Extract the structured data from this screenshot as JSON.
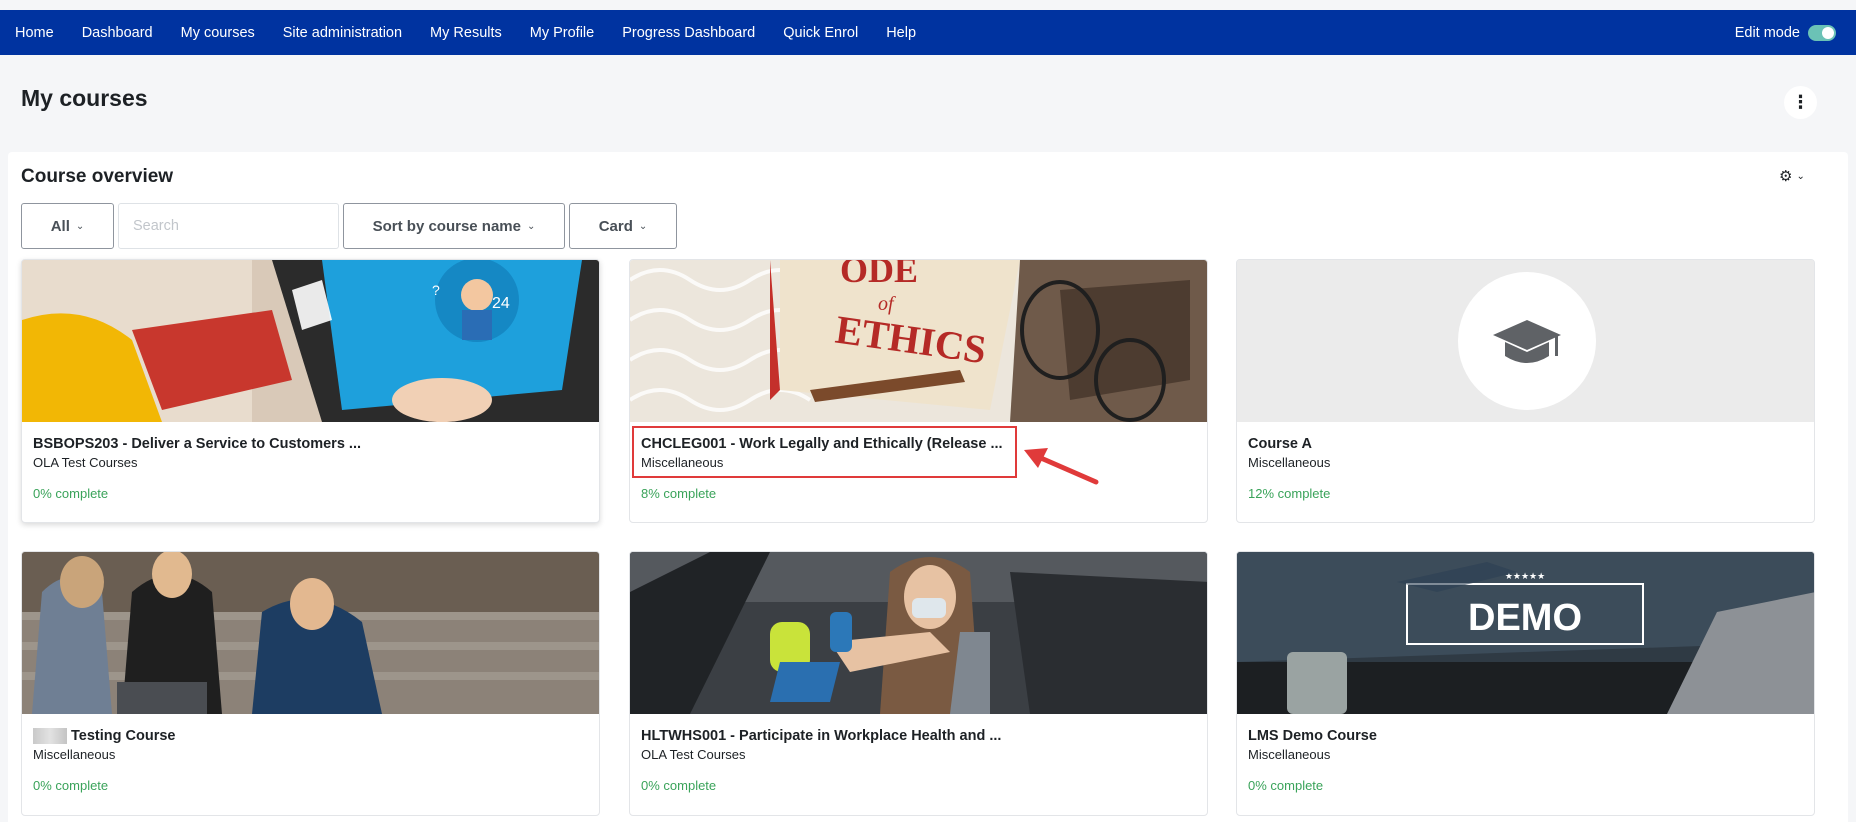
{
  "nav": {
    "items": [
      "Home",
      "Dashboard",
      "My courses",
      "Site administration",
      "My Results",
      "My Profile",
      "Progress Dashboard",
      "Quick Enrol",
      "Help"
    ],
    "edit_mode_label": "Edit mode",
    "bg_color": "#0033a0"
  },
  "page": {
    "title": "My courses"
  },
  "overview": {
    "title": "Course overview",
    "filter_label": "All",
    "search_placeholder": "Search",
    "sort_label": "Sort by course name",
    "view_label": "Card"
  },
  "courses": [
    {
      "title": "BSBOPS203 - Deliver a Service to Customers ...",
      "category": "OLA Test Courses",
      "progress": "0% complete"
    },
    {
      "title": "CHCLEG001 - Work Legally and Ethically (Release ...",
      "category": "Miscellaneous",
      "progress": "8% complete"
    },
    {
      "title": "Course A",
      "category": "Miscellaneous",
      "progress": "12% complete"
    },
    {
      "title": "Testing Course",
      "category": "Miscellaneous",
      "progress": "0% complete"
    },
    {
      "title": "HLTWHS001 - Participate in Workplace Health and ...",
      "category": "OLA Test Courses",
      "progress": "0% complete"
    },
    {
      "title": "LMS Demo Course",
      "category": "Miscellaneous",
      "progress": "0% complete"
    }
  ],
  "images": {
    "ethics_text_1": "ODE",
    "ethics_text_2": "of",
    "ethics_text_3": "ETHICS",
    "support_number": "24",
    "demo_text": "DEMO",
    "demo_stars": "★★★★★"
  },
  "colors": {
    "progress_green": "#3aa35a",
    "highlight_red": "#e03a3a"
  }
}
